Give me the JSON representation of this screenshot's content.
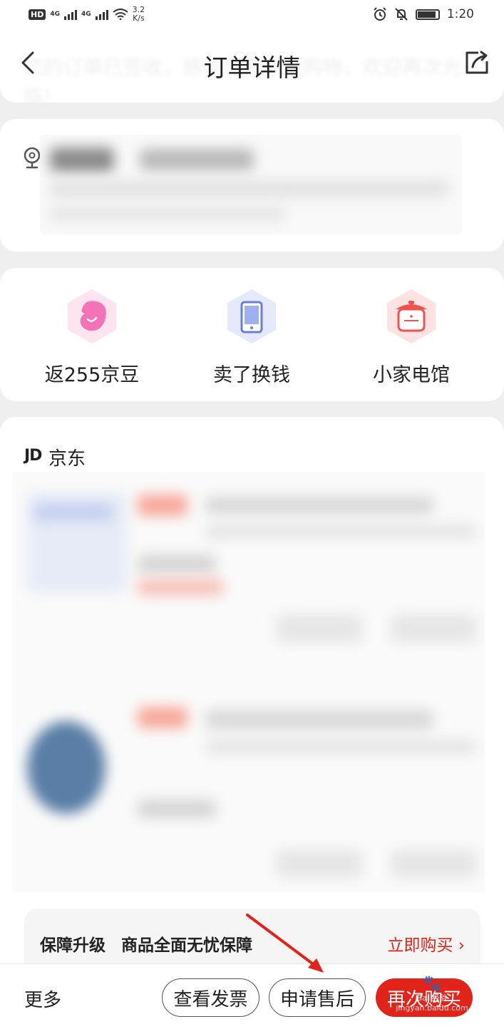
{
  "status_bar": {
    "hd": "HD",
    "net1": "4G",
    "net2": "4G",
    "speed_value": "3.2",
    "speed_unit": "K/s",
    "time": "1:20"
  },
  "header": {
    "title": "订单详情",
    "background_notice": "您的订单已签收，感谢您在京东购物，欢迎再次光临！"
  },
  "perks": [
    {
      "label": "返255京豆",
      "icon": "bean-icon",
      "color": "#f472b6"
    },
    {
      "label": "卖了换钱",
      "icon": "tablet-icon",
      "color": "#6b7fd7"
    },
    {
      "label": "小家电馆",
      "icon": "rice-cooker-icon",
      "color": "#ef5350"
    }
  ],
  "shop": {
    "logo": "JD",
    "name": "京东"
  },
  "protection": {
    "title": "保障升级",
    "subtitle": "商品全面无忧保障",
    "link": "立即购买 ›"
  },
  "bottom_bar": {
    "more": "更多",
    "invoice": "查看发票",
    "after_sale": "申请售后",
    "buy_again": "再次购买"
  },
  "watermark": {
    "line1": "Bai 经验",
    "line2": "jingyan.baidu.com"
  },
  "colors": {
    "accent": "#e2231a",
    "background": "#efefef"
  }
}
